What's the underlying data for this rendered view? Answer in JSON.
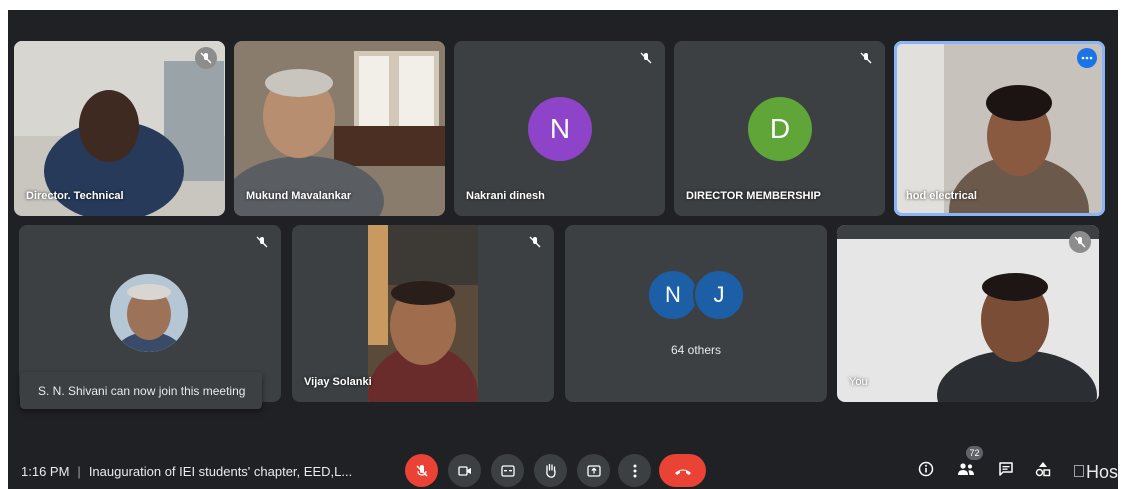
{
  "participants": [
    {
      "name": "Director. Technical",
      "muted": true
    },
    {
      "name": "Mukund Mavalankar",
      "muted": false
    },
    {
      "name": "Nakrani dinesh",
      "initial": "N",
      "avatar_color": "#8e44c9",
      "muted": true
    },
    {
      "name": "DIRECTOR MEMBERSHIP",
      "initial": "D",
      "avatar_color": "#5fa537",
      "muted": true
    },
    {
      "name": "hod electrical",
      "speaking": true
    },
    {
      "name": "S. N. Shivani",
      "muted": true
    },
    {
      "name": "Vijay Solanki",
      "muted": true
    },
    {
      "name": "You",
      "muted": true
    }
  ],
  "others_group": {
    "initials": [
      "N",
      "J"
    ],
    "label": "64 others",
    "avatar_color": "#1d5fa6"
  },
  "notification": "S. N. Shivani can now join this meeting",
  "bottom_bar": {
    "time": "1:16 PM",
    "separator": "|",
    "meeting_title": "Inauguration of IEI students' chapter, EED,L...",
    "participant_count": "72",
    "brand_text": "Hos"
  },
  "colors": {
    "background": "#202124",
    "tile": "#3c4043",
    "accent": "#1a73e8",
    "danger": "#ea4335",
    "speaking_outline": "#8ab4f8"
  }
}
